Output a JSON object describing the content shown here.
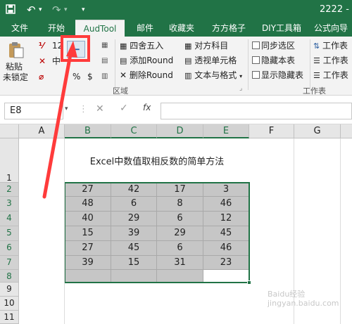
{
  "titlebar": {
    "save_icon": "save-icon",
    "undo_icon": "undo-icon",
    "redo_icon": "redo-icon",
    "doc_name": "2222 -"
  },
  "tabs": [
    "文件",
    "开始",
    "AudTool",
    "邮件",
    "收藏夹",
    "方方格子",
    "DIY工具箱",
    "公式向导"
  ],
  "active_tab": "AudTool",
  "ribbon": {
    "paste": "粘贴",
    "unlock": "未锁定",
    "digits": [
      "12",
      "中",
      "%",
      "$"
    ],
    "minus_btn": "−",
    "round": "四舍五入",
    "add_round": "添加Round",
    "del_round": "删除Round",
    "align_subject": "对方科目",
    "pivot_cell": "透视单元格",
    "text_number": "文本与格式",
    "group_area": "区域",
    "sync_sel": "同步选区",
    "hide_sheet": "隐藏本表",
    "show_hidden": "显示隐藏表",
    "ws1": "工作表",
    "ws2": "工作表",
    "ws3": "工作表",
    "group_ws": "工作表"
  },
  "formula_bar": {
    "name_box": "E8",
    "fx": "fx",
    "formula": ""
  },
  "columns": [
    "A",
    "B",
    "C",
    "D",
    "E",
    "F",
    "G"
  ],
  "rows": [
    "1",
    "2",
    "3",
    "4",
    "5",
    "6",
    "7",
    "8",
    "9",
    "10",
    "11"
  ],
  "sheet_title": "Excel中数值取相反数的简单方法",
  "table": [
    [
      "27",
      "42",
      "17",
      "3"
    ],
    [
      "48",
      "6",
      "8",
      "46"
    ],
    [
      "40",
      "29",
      "6",
      "12"
    ],
    [
      "15",
      "39",
      "29",
      "45"
    ],
    [
      "27",
      "45",
      "6",
      "46"
    ],
    [
      "39",
      "15",
      "31",
      "23"
    ],
    [
      "",
      "",
      "",
      ""
    ]
  ],
  "watermark": "Baidu经验 jingyan.baidu.com",
  "colors": {
    "accent": "#217346",
    "highlight": "#ff3b3b"
  }
}
